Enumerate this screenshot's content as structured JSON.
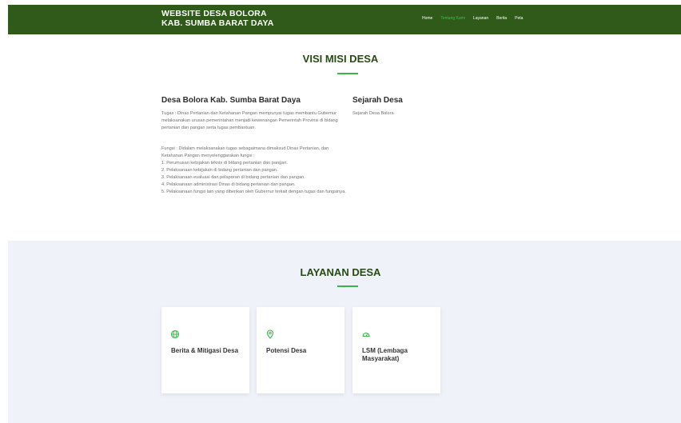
{
  "header": {
    "brand_line1": "WEBSITE DESA BOLORA",
    "brand_line2": "KAB. SUMBA BARAT DAYA",
    "nav": [
      "Home",
      "Tentang Kami",
      "Layanan",
      "Berita",
      "Peta"
    ],
    "active_nav": "Tentang Kami"
  },
  "visi": {
    "heading": "VISI MISI DESA",
    "left_title": "Desa Bolora Kab. Sumba Barat Daya",
    "tugas": "Tugas : Dinas Pertanian dan Ketahanan Pangan mempunyai tugas membantu Gubernur melaksanakan urusan pemerintahan menjadi kewenangan Pemerintah Provinsi di bidang pertanian dan pangan serta tugas pembantuan.",
    "fungsi_intro": "Fungsi : Didalam melaksanakan tugas sebagaimana dimaksud Dinas Pertanian, dan Ketahanan Pangan menyelenggarakan fungsi :",
    "fungsi_items": [
      "1. Perumusan kebijakan teknis di bidang pertanian dan pangan.",
      "2. Pelaksanaan kebijakan di bidang pertanian dan pangan.",
      "3. Pelaksanaan evaluasi dan pelaporan di bidang pertanian dan pangan.",
      "4. Pelaksanaan administrasi Dinas di bidang pertanian dan pangan.",
      "5. Pelaksanaan fungsi lain yang diberikan oleh Gubernur terkait dengan tugas dan fungsinya."
    ],
    "right_title": "Sejarah Desa",
    "right_text": "Sejarah Desa Bolora"
  },
  "layanan": {
    "heading": "LAYANAN DESA",
    "cards": [
      {
        "label": "Berita & Mitigasi Desa",
        "icon": "globe-icon"
      },
      {
        "label": "Potensi Desa",
        "icon": "map-pin-icon"
      },
      {
        "label": "LSM (Lembaga Masyarakat)",
        "icon": "gauge-icon"
      }
    ]
  },
  "colors": {
    "header_bg": "#2f5a1a",
    "accent": "#3bb54a",
    "heading": "#274a15",
    "section_bg": "#eff3f9"
  }
}
